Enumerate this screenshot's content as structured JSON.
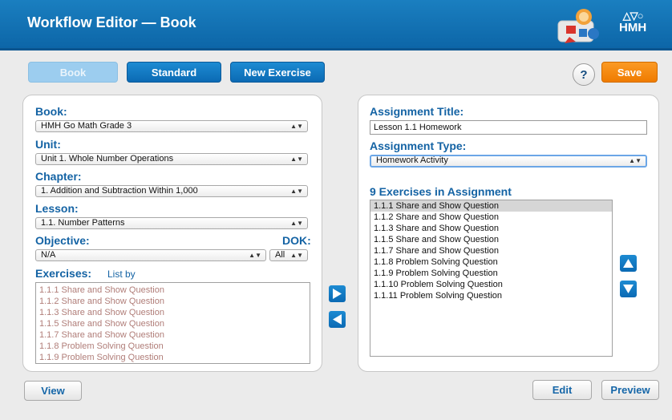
{
  "header": {
    "title": "Workflow Editor — Book",
    "brand": "HMH"
  },
  "toolbar": {
    "book": "Book",
    "standard": "Standard",
    "new_exercise": "New Exercise",
    "help": "?",
    "save": "Save"
  },
  "left": {
    "book_label": "Book:",
    "book_value": "HMH Go Math Grade 3",
    "unit_label": "Unit:",
    "unit_value": "Unit 1. Whole Number Operations",
    "chapter_label": "Chapter:",
    "chapter_value": "1. Addition and Subtraction Within 1,000",
    "lesson_label": "Lesson:",
    "lesson_value": "1.1. Number Patterns",
    "objective_label": "Objective:",
    "objective_value": "N/A",
    "dok_label": "DOK:",
    "dok_value": "All",
    "exercises_label": "Exercises:",
    "list_by": "List by",
    "exercises": [
      "1.1.1 Share and Show Question",
      "1.1.2 Share and Show Question",
      "1.1.3 Share and Show Question",
      "1.1.5 Share and Show Question",
      "1.1.7 Share and Show Question",
      "1.1.8 Problem Solving Question",
      "1.1.9 Problem Solving Question"
    ]
  },
  "right": {
    "title_label": "Assignment Title:",
    "title_value": "Lesson 1.1 Homework",
    "type_label": "Assignment Type:",
    "type_value": "Homework Activity",
    "list_heading": "9 Exercises in Assignment",
    "items": [
      "1.1.1 Share and Show Question",
      "1.1.2 Share and Show Question",
      "1.1.3 Share and Show Question",
      "1.1.5 Share and Show Question",
      "1.1.7 Share and Show Question",
      "1.1.8 Problem Solving Question",
      "1.1.9 Problem Solving Question",
      "1.1.10 Problem Solving Question",
      "1.1.11 Problem Solving Question"
    ]
  },
  "footer": {
    "view": "View",
    "edit": "Edit",
    "preview": "Preview"
  }
}
